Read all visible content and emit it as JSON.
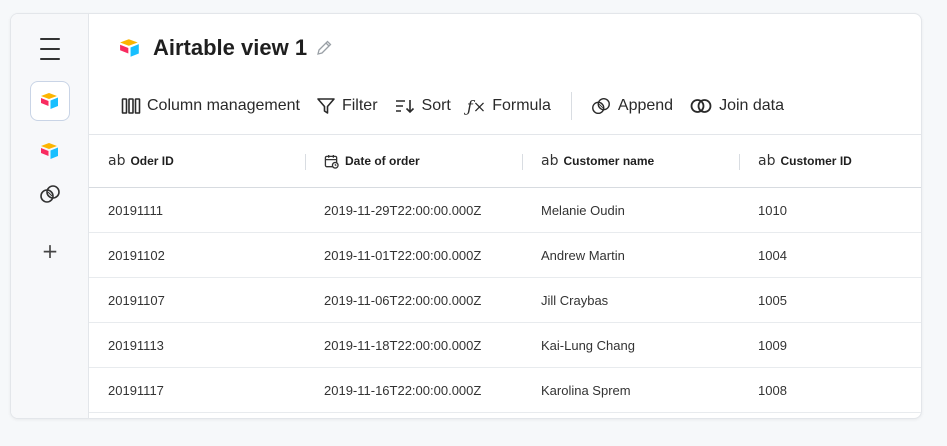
{
  "header": {
    "title": "Airtable view 1"
  },
  "toolbar": {
    "column_management": "Column management",
    "filter": "Filter",
    "sort": "Sort",
    "formula": "Formula",
    "append": "Append",
    "join_data": "Join data"
  },
  "sidebar": {
    "add": "+"
  },
  "table": {
    "columns": [
      {
        "label": "Oder ID",
        "type": "ab"
      },
      {
        "label": "Date of order",
        "type": "calendar"
      },
      {
        "label": "Customer name",
        "type": "ab"
      },
      {
        "label": "Customer ID",
        "type": "ab"
      }
    ],
    "rows": [
      [
        "20191111",
        "2019-11-29T22:00:00.000Z",
        "Melanie Oudin",
        "1010"
      ],
      [
        "20191102",
        "2019-11-01T22:00:00.000Z",
        "Andrew Martin",
        "1004"
      ],
      [
        "20191107",
        "2019-11-06T22:00:00.000Z",
        "Jill Craybas",
        "1005"
      ],
      [
        "20191113",
        "2019-11-18T22:00:00.000Z",
        "Kai-Lung Chang",
        "1009"
      ],
      [
        "20191117",
        "2019-11-16T22:00:00.000Z",
        "Karolina Sprem",
        "1008"
      ]
    ]
  },
  "icons": {
    "airtable": "airtable-logo-icon",
    "menu": "hamburger-icon",
    "venn": "venn-icon",
    "pencil": "pencil-icon",
    "columns": "columns-icon",
    "filter": "filter-icon",
    "sort": "sort-icon",
    "append": "append-icon",
    "join": "join-icon",
    "calendar": "calendar-icon"
  },
  "colors": {
    "airtable_yellow": "#fcb400",
    "airtable_blue": "#18bfff",
    "airtable_red": "#f82b60",
    "active_border": "#c9d4e6"
  }
}
